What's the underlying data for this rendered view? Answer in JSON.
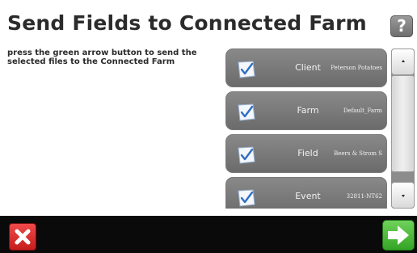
{
  "header": {
    "title": "Send Fields to Connected Farm",
    "help_label": "?"
  },
  "instructions": "press the green arrow button to send the selected files to the Connected Farm",
  "items": [
    {
      "label": "Client",
      "value": "Peterson Potatoes",
      "icon": "selection-checkbox-icon"
    },
    {
      "label": "Farm",
      "value": "Default_Farm",
      "icon": "selection-checkbox-icon"
    },
    {
      "label": "Field",
      "value": "Beers & Strom S",
      "icon": "selection-checkbox-icon"
    },
    {
      "label": "Event",
      "value": "32811-NT62",
      "icon": "selection-checkbox-icon"
    }
  ],
  "scrollbar": {
    "up_icon": "chevron-up-icon",
    "down_icon": "chevron-down-icon"
  },
  "footer": {
    "cancel_icon": "close-icon",
    "send_icon": "arrow-right-icon"
  },
  "colors": {
    "accent_send": "#34a425",
    "accent_cancel": "#d42020",
    "item_background": "#7a7a7a",
    "bottom_bar": "#0a0a0a"
  }
}
